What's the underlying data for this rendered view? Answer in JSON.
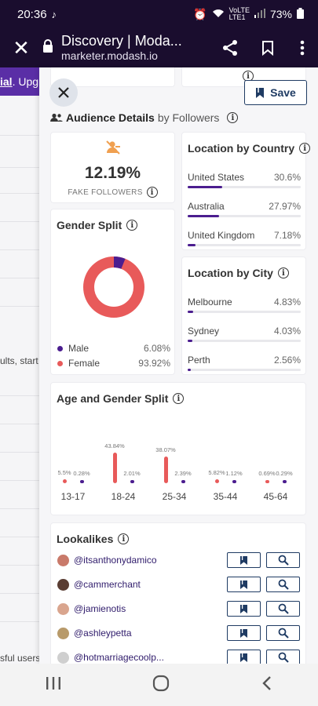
{
  "status_bar": {
    "time": "20:36",
    "battery": "73%",
    "volte": "VoLTE",
    "lte": "LTE1"
  },
  "browser": {
    "title": "Discovery | Moda...",
    "url": "marketer.modash.io"
  },
  "background": {
    "trial_bold": "ial",
    "trial_rest": ". Upgr",
    "side_text_1": "ults, start",
    "side_text_2": "sful users"
  },
  "panel": {
    "save_label": "Save",
    "section_title": "Audience Details",
    "section_sub": "by Followers",
    "fake_followers": {
      "value": "12.19%",
      "label": "FAKE FOLLOWERS"
    },
    "gender_split": {
      "title": "Gender Split",
      "items": [
        {
          "label": "Male",
          "value": "6.08%",
          "color": "#4b1d8f"
        },
        {
          "label": "Female",
          "value": "93.92%",
          "color": "#e85a5a"
        }
      ],
      "male_fraction": 0.0608
    },
    "location_country": {
      "title": "Location by Country",
      "items": [
        {
          "name": "United States",
          "pct": "30.6%",
          "fraction": 0.306
        },
        {
          "name": "Australia",
          "pct": "27.97%",
          "fraction": 0.2797
        },
        {
          "name": "United Kingdom",
          "pct": "7.18%",
          "fraction": 0.0718
        }
      ]
    },
    "location_city": {
      "title": "Location by City",
      "items": [
        {
          "name": "Melbourne",
          "pct": "4.83%",
          "fraction": 0.0483
        },
        {
          "name": "Sydney",
          "pct": "4.03%",
          "fraction": 0.0403
        },
        {
          "name": "Perth",
          "pct": "2.56%",
          "fraction": 0.0256
        }
      ]
    },
    "age_gender": {
      "title": "Age and Gender Split",
      "groups": [
        {
          "label": "13-17",
          "female": "5.5%",
          "male": "0.28%",
          "female_value": 5.5,
          "male_value": 0.28
        },
        {
          "label": "18-24",
          "female": "43.84%",
          "male": "2.01%",
          "female_value": 43.84,
          "male_value": 2.01
        },
        {
          "label": "25-34",
          "female": "38.07%",
          "male": "2.39%",
          "female_value": 38.07,
          "male_value": 2.39
        },
        {
          "label": "35-44",
          "female": "5.82%",
          "male": "1.12%",
          "female_value": 5.82,
          "male_value": 1.12
        },
        {
          "label": "45-64",
          "female": "0.69%",
          "male": "0.29%",
          "female_value": 0.69,
          "male_value": 0.29
        }
      ]
    },
    "lookalikes": {
      "title": "Lookalikes",
      "items": [
        {
          "handle": "@itsanthonydamico",
          "avatar_color": "#c97a6a"
        },
        {
          "handle": "@cammerchant",
          "avatar_color": "#5a3d33"
        },
        {
          "handle": "@jamienotis",
          "avatar_color": "#d9a58e"
        },
        {
          "handle": "@ashleypetta",
          "avatar_color": "#b89a6a"
        },
        {
          "handle": "@hotmarriagecoolp...",
          "avatar_color": "#cfcfcf"
        }
      ]
    }
  },
  "chart_data": [
    {
      "type": "pie",
      "title": "Gender Split",
      "categories": [
        "Male",
        "Female"
      ],
      "values": [
        6.08,
        93.92
      ]
    },
    {
      "type": "bar",
      "title": "Age and Gender Split",
      "categories": [
        "13-17",
        "18-24",
        "25-34",
        "35-44",
        "45-64"
      ],
      "series": [
        {
          "name": "Female",
          "values": [
            5.5,
            43.84,
            38.07,
            5.82,
            0.69
          ]
        },
        {
          "name": "Male",
          "values": [
            0.28,
            2.01,
            2.39,
            1.12,
            0.29
          ]
        }
      ]
    }
  ]
}
